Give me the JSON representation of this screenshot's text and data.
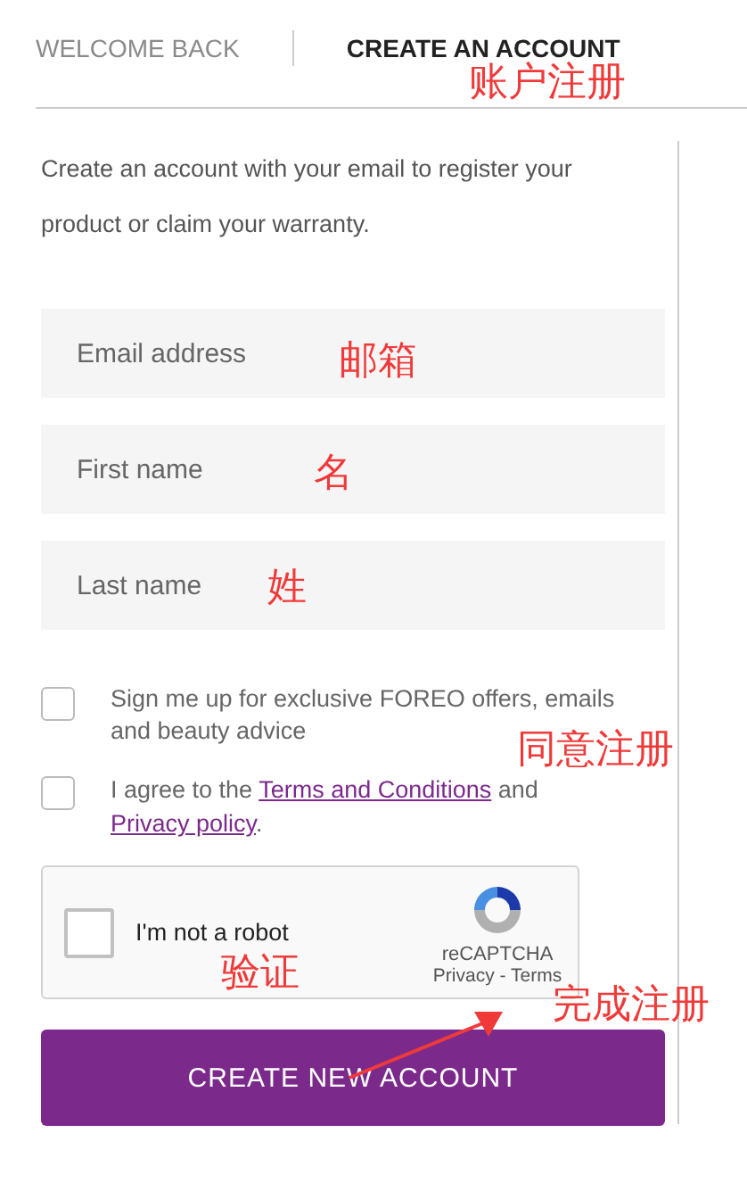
{
  "tabs": [
    {
      "label": "WELCOME BACK",
      "selected": false
    },
    {
      "label": "CREATE AN ACCOUNT",
      "selected": true
    }
  ],
  "intro": "Create an account with your email to register your product or claim your warranty.",
  "fields": [
    {
      "placeholder": "Email address"
    },
    {
      "placeholder": "First name"
    },
    {
      "placeholder": "Last name"
    }
  ],
  "consents": [
    {
      "text": "Sign me up for exclusive FOREO offers, emails and beauty advice",
      "checked": false
    },
    {
      "text": "I agree to the ",
      "links": [
        "Terms and Conditions",
        "Privacy policy"
      ],
      "between": " and ",
      "end": ".",
      "checked": false
    }
  ],
  "captcha": {
    "label": "I'm not a robot",
    "checked": false,
    "brand": "reCAPTCHA",
    "privacy": "Privacy",
    "separator": " - ",
    "terms": "Terms"
  },
  "submit": "CREATE NEW ACCOUNT",
  "annotations": [
    {
      "text": "账户注册"
    },
    {
      "text": "邮箱"
    },
    {
      "text": "名"
    },
    {
      "text": "姓"
    },
    {
      "text": "同意注册"
    },
    {
      "text": "验证"
    },
    {
      "text": "完成注册"
    }
  ]
}
